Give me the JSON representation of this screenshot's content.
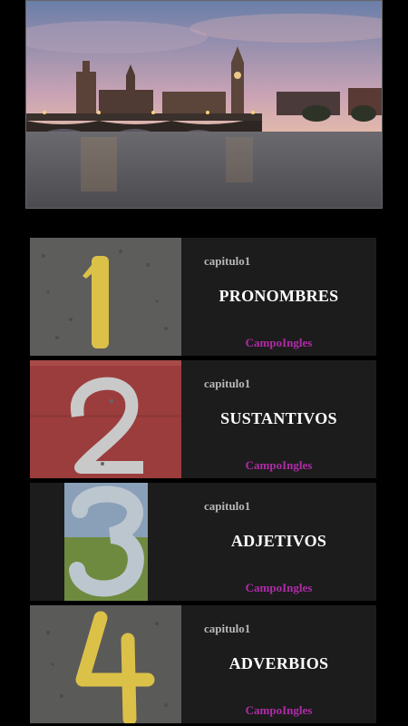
{
  "hero": {
    "image": "london-westminster-bridge-sunset"
  },
  "lessons": [
    {
      "number": "1",
      "chapter": "capitulo1",
      "title": "PRONOMBRES",
      "author": "CampoIngles",
      "thumb": "yellow-painted-1-asphalt"
    },
    {
      "number": "2",
      "chapter": "capitulo1",
      "title": "SUSTANTIVOS",
      "author": "CampoIngles",
      "thumb": "metal-2-red-wall"
    },
    {
      "number": "3",
      "chapter": "capitulo1",
      "title": "ADJETIVOS",
      "author": "CampoIngles",
      "thumb": "mirror-3-reflection"
    },
    {
      "number": "4",
      "chapter": "capitulo1",
      "title": "ADVERBIOS",
      "author": "CampoIngles",
      "thumb": "yellow-painted-4-asphalt"
    }
  ],
  "colors": {
    "background": "#000000",
    "card": "#1c1c1c",
    "chapter_text": "#b7b7b7",
    "title_text": "#ffffff",
    "author_text": "#b02ca8"
  }
}
